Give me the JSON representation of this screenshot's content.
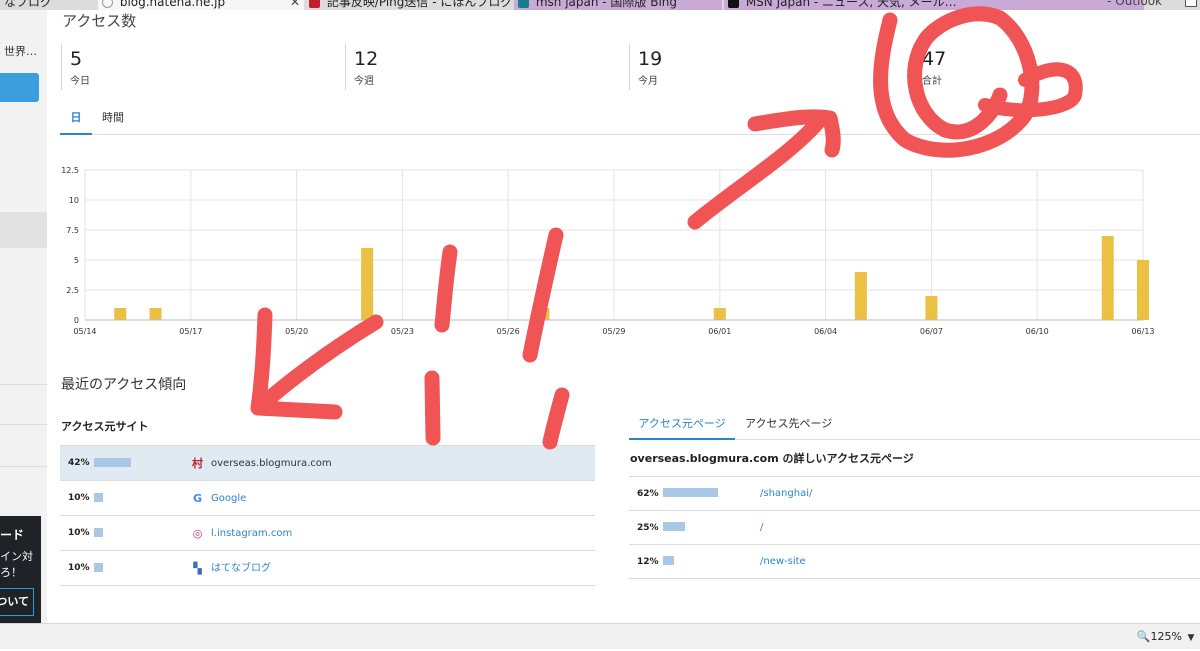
{
  "browser": {
    "tabs": [
      {
        "label": "なブログ",
        "color": "#dcdcdc",
        "icon": ""
      },
      {
        "label": "blog.hatena.ne.jp",
        "color": "#f7f7f7",
        "icon": "#999999"
      },
      {
        "label": "記事反映/Ping送信 - にほんブログ…",
        "color": "#dcdcdc",
        "icon": "#c21e2b"
      },
      {
        "label": "msn japan - 国際版 Bing",
        "color": "#c9a9d6",
        "icon": "#1a7c8f"
      },
      {
        "label": "MSN Japan - ニュース, 天気, メール…",
        "color": "#c9a9d6",
        "icon": "#111111"
      }
    ],
    "tab_tail": "- Outlook"
  },
  "sidebar": {
    "partial_text": "世界…",
    "promo": {
      "title": "ード",
      "line1": "イン対",
      "line2": "ろ！",
      "button": "ついて"
    }
  },
  "access": {
    "title": "アクセス数",
    "stats": [
      {
        "value": "5",
        "label": "今日"
      },
      {
        "value": "12",
        "label": "今週"
      },
      {
        "value": "19",
        "label": "今月"
      },
      {
        "value": "47",
        "label": "合計"
      }
    ],
    "tabs": [
      "日",
      "時間"
    ],
    "active_tab": 0
  },
  "chart_data": {
    "type": "bar",
    "color": "#ecc043",
    "xmin": 0,
    "xmax": 30,
    "ylim": [
      0,
      12.5
    ],
    "yticks": [
      "0",
      "2.5",
      "5",
      "7.5",
      "10",
      "12.5"
    ],
    "xticks": [
      {
        "i": 0,
        "label": "05/14"
      },
      {
        "i": 3,
        "label": "05/17"
      },
      {
        "i": 6,
        "label": "05/20"
      },
      {
        "i": 9,
        "label": "05/23"
      },
      {
        "i": 12,
        "label": "05/26"
      },
      {
        "i": 15,
        "label": "05/29"
      },
      {
        "i": 18,
        "label": "06/01"
      },
      {
        "i": 21,
        "label": "06/04"
      },
      {
        "i": 24,
        "label": "06/07"
      },
      {
        "i": 27,
        "label": "06/10"
      },
      {
        "i": 30,
        "label": "06/13"
      }
    ],
    "points": [
      {
        "date": "05/15",
        "i": 1,
        "value": 1
      },
      {
        "date": "05/16",
        "i": 2,
        "value": 1
      },
      {
        "date": "05/22",
        "i": 8,
        "value": 6
      },
      {
        "date": "05/27",
        "i": 13,
        "value": 1
      },
      {
        "date": "06/01",
        "i": 18,
        "value": 1
      },
      {
        "date": "06/05",
        "i": 22,
        "value": 4
      },
      {
        "date": "06/07",
        "i": 24,
        "value": 2
      },
      {
        "date": "06/12",
        "i": 29,
        "value": 7
      },
      {
        "date": "06/13",
        "i": 30,
        "value": 5
      }
    ]
  },
  "trends": {
    "title": "最近のアクセス傾向",
    "referrers_title": "アクセス元サイト",
    "referrers": [
      {
        "pct": "42%",
        "share": 0.42,
        "name": "overseas.blogmura.com",
        "icon": "村",
        "icon_color": "#c21e2b"
      },
      {
        "pct": "10%",
        "share": 0.1,
        "name": "Google",
        "icon": "G",
        "icon_color": "#4285f4"
      },
      {
        "pct": "10%",
        "share": 0.1,
        "name": "l.instagram.com",
        "icon": "◎",
        "icon_color": "#c13584"
      },
      {
        "pct": "10%",
        "share": 0.1,
        "name": "はてなブログ",
        "icon": "▚",
        "icon_color": "#3b6cc4"
      }
    ],
    "page_tabs": [
      "アクセス元ページ",
      "アクセス先ページ"
    ],
    "active_page_tab": 0,
    "detail_title": "overseas.blogmura.com の詳しいアクセス元ページ",
    "pages": [
      {
        "pct": "62%",
        "share": 0.62,
        "path": "/shanghai/"
      },
      {
        "pct": "25%",
        "share": 0.25,
        "path": "/"
      },
      {
        "pct": "12%",
        "share": 0.12,
        "path": "/new-site"
      }
    ]
  },
  "status": {
    "zoom": "125%"
  }
}
